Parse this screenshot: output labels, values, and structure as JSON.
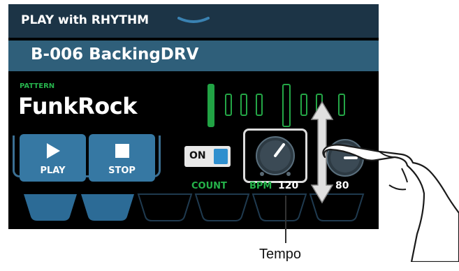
{
  "header": {
    "title": "PLAY with RHYTHM",
    "menu_icon": "chevron-down-icon"
  },
  "rhythm": {
    "name": "B-006 BackingDRV"
  },
  "pattern": {
    "label": "PATTERN",
    "name": "FunkRock"
  },
  "beats": {
    "total": 8,
    "active_index": 0,
    "accent_index": 4
  },
  "controls": {
    "play_label": "PLAY",
    "stop_label": "STOP",
    "count_toggle": "ON",
    "count_label": "COUNT",
    "bpm_label": "BPM",
    "bpm_value": "120",
    "level_label": "L",
    "level_value": "80"
  },
  "callout": {
    "label": "Tempo"
  },
  "colors": {
    "accent_green": "#21a344",
    "button_blue": "#3678a3",
    "header_bg": "#1c3446",
    "namebar_bg": "#2f5f7a"
  }
}
